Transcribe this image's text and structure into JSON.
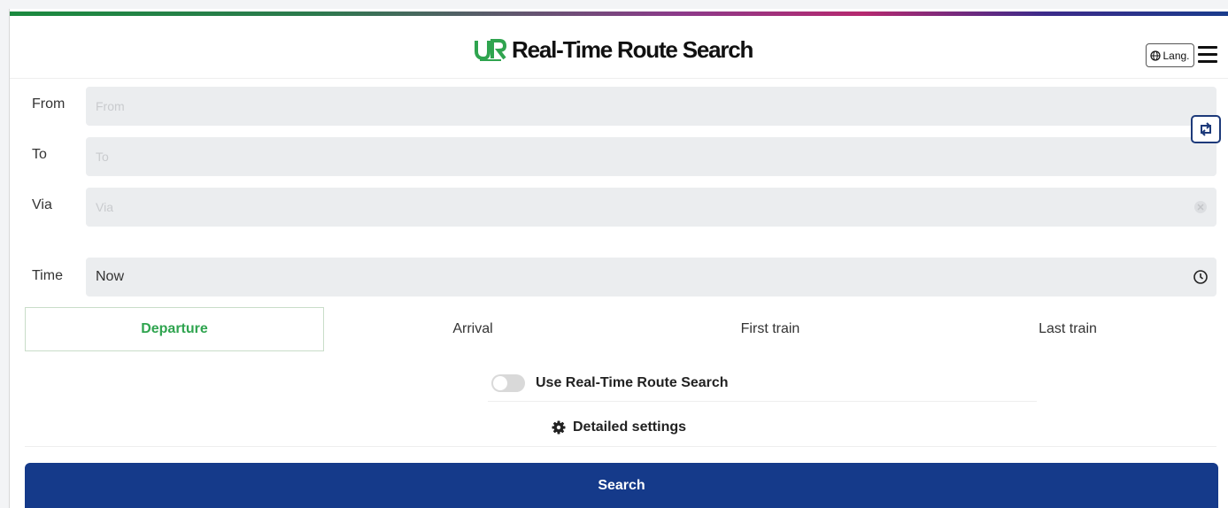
{
  "header": {
    "title": "Real-Time Route Search",
    "logo_icon": "jr-logo-icon",
    "lang_label": "Lang.",
    "menu_icon": "hamburger-menu-icon"
  },
  "form": {
    "from": {
      "label": "From",
      "placeholder": "From",
      "value": ""
    },
    "to": {
      "label": "To",
      "placeholder": "To",
      "value": ""
    },
    "via": {
      "label": "Via",
      "placeholder": "Via",
      "value": ""
    },
    "time": {
      "label": "Time",
      "value": "Now"
    },
    "swap_icon": "swap-icon",
    "clock_icon": "clock-icon",
    "via_clear_icon": "clear-icon"
  },
  "tabs": [
    {
      "label": "Departure",
      "active": true
    },
    {
      "label": "Arrival",
      "active": false
    },
    {
      "label": "First train",
      "active": false
    },
    {
      "label": "Last train",
      "active": false
    }
  ],
  "realtime": {
    "label": "Use Real-Time Route Search",
    "enabled": false
  },
  "settings": {
    "label": "Detailed settings",
    "icon": "gear-icon"
  },
  "search": {
    "label": "Search"
  },
  "colors": {
    "accent_green": "#2fa44f",
    "search_blue": "#153a8a",
    "field_bg": "#ebedef"
  }
}
